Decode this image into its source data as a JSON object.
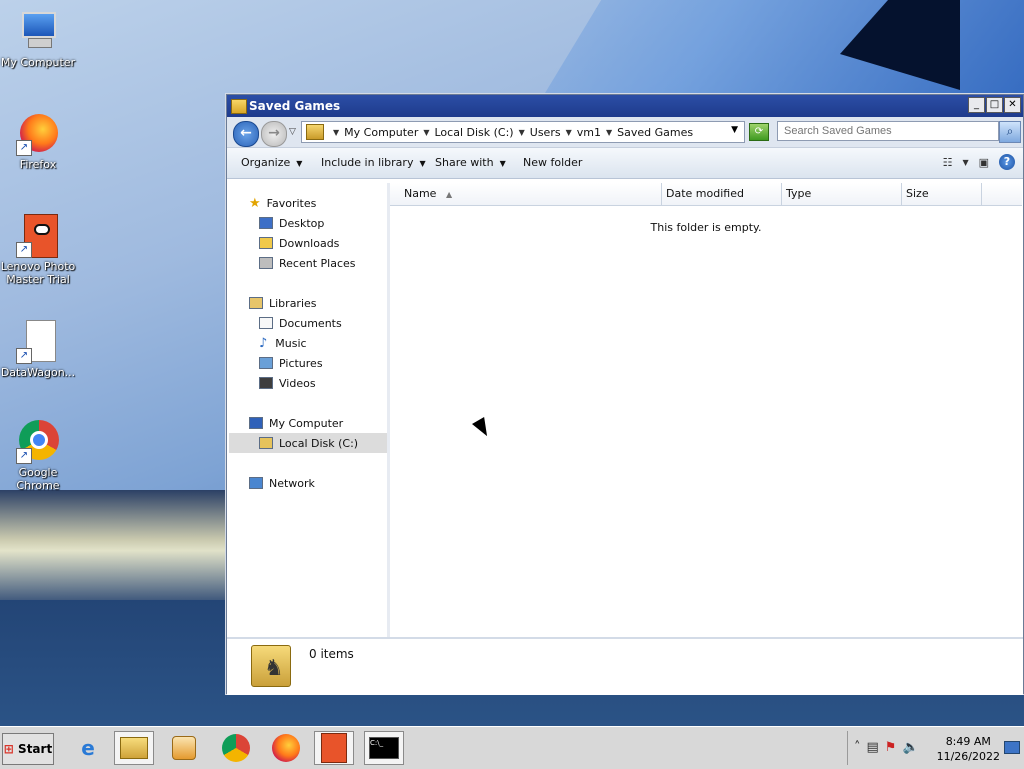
{
  "desktop": {
    "icons": [
      {
        "label": "My Computer"
      },
      {
        "label": "Firefox"
      },
      {
        "label": "Lenovo Photo Master Trial"
      },
      {
        "label": "DataWagon..."
      },
      {
        "label": "Google Chrome"
      }
    ]
  },
  "window": {
    "title": "Saved Games",
    "controls": {
      "minimize": "_",
      "maximize": "□",
      "close": "✕"
    },
    "breadcrumb": [
      "My Computer",
      "Local Disk (C:)",
      "Users",
      "vm1",
      "Saved Games"
    ],
    "search": {
      "placeholder": "Search Saved Games"
    },
    "toolbar": {
      "organize": "Organize",
      "include": "Include in library",
      "share": "Share with",
      "new_folder": "New folder"
    },
    "nav": {
      "favorites": "Favorites",
      "favorites_items": [
        "Desktop",
        "Downloads",
        "Recent Places"
      ],
      "libraries": "Libraries",
      "libraries_items": [
        "Documents",
        "Music",
        "Pictures",
        "Videos"
      ],
      "computer": "My Computer",
      "computer_items": [
        "Local Disk (C:)"
      ],
      "network": "Network"
    },
    "columns": [
      "Name",
      "Date modified",
      "Type",
      "Size"
    ],
    "empty_message": "This folder is empty.",
    "status": "0 items"
  },
  "taskbar": {
    "start_label": "Start",
    "time": "8:49 AM",
    "date": "11/26/2022"
  },
  "colors": {
    "titlebar": "#1e3b8c",
    "taskbar": "#d8d8d8",
    "selection": "#dcdcdc"
  }
}
